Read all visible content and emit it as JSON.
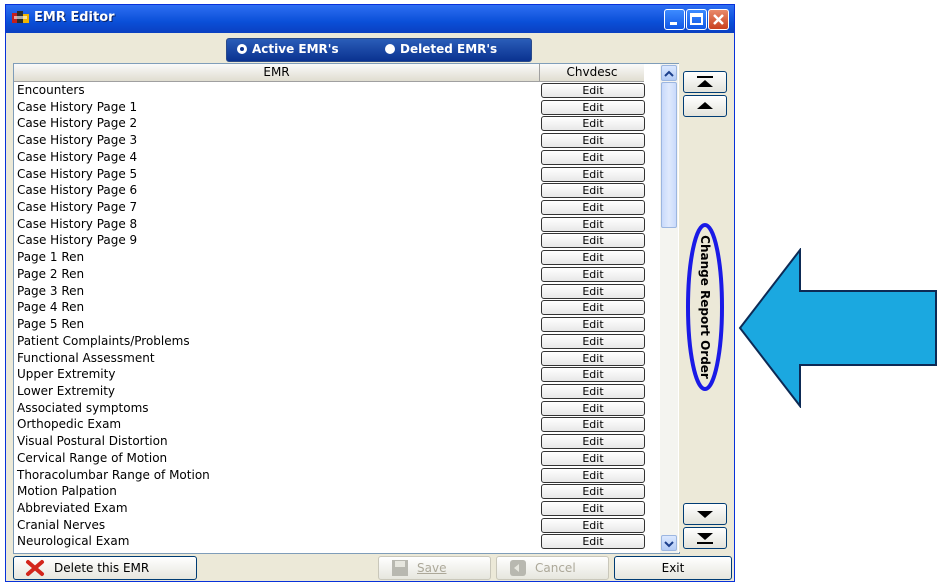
{
  "window": {
    "title": "EMR Editor"
  },
  "toggle": {
    "active_label": "Active EMR's",
    "deleted_label": "Deleted EMR's",
    "selected": "active"
  },
  "table": {
    "columns": [
      "EMR",
      "Chvdesc"
    ],
    "edit_label": "Edit",
    "rows": [
      "Encounters",
      "Case History Page 1",
      "Case History Page 2",
      "Case History Page 3",
      "Case History Page 4",
      "Case History Page 5",
      "Case History Page 6",
      "Case History Page 7",
      "Case History Page 8",
      "Case History Page 9",
      "Page 1 Ren",
      "Page 2 Ren",
      "Page 3 Ren",
      "Page 4 Ren",
      "Page 5 Ren",
      "Patient Complaints/Problems",
      "Functional Assessment",
      "Upper Extremity",
      "Lower Extremity",
      "Associated symptoms",
      "Orthopedic Exam",
      "Visual Postural Distortion",
      "Cervical Range of Motion",
      "Thoracolumbar Range of Motion",
      "Motion Palpation",
      "Abbreviated Exam",
      "Cranial Nerves",
      "Neurological Exam"
    ]
  },
  "side": {
    "change_order_label": "Change Report Order"
  },
  "buttons": {
    "delete_label": "Delete this EMR",
    "save_label": "Save",
    "cancel_label": "Cancel",
    "exit_label": "Exit"
  },
  "colors": {
    "title_bar": "#0a4fd8",
    "annotation_arrow": "#1ba8e0",
    "annotation_ellipse": "#1a1ae6"
  }
}
